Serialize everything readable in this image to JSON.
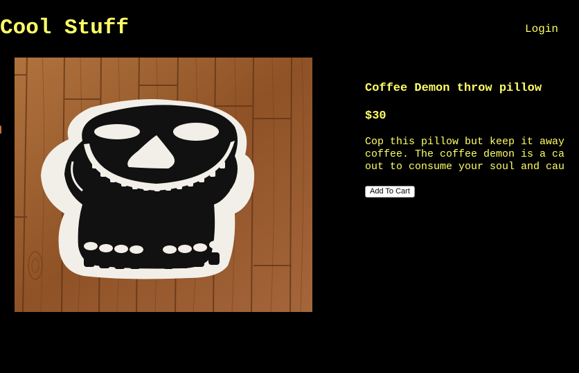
{
  "site": {
    "title": "Cool Stuff",
    "login_label": "Login"
  },
  "product": {
    "name": "Coffee Demon throw pillow",
    "price": "$30",
    "description_lines": [
      "Cop this pillow but keep it away",
      "coffee. The coffee demon is a ca",
      "out to consume your soul and cau"
    ],
    "add_to_cart_label": "Add To Cart",
    "image_icon": "skull-pillow-photo"
  },
  "colors": {
    "background": "#000000",
    "accent_text": "#ffff66",
    "button_bg": "#ffffff",
    "wood": "#9a5a2c"
  }
}
